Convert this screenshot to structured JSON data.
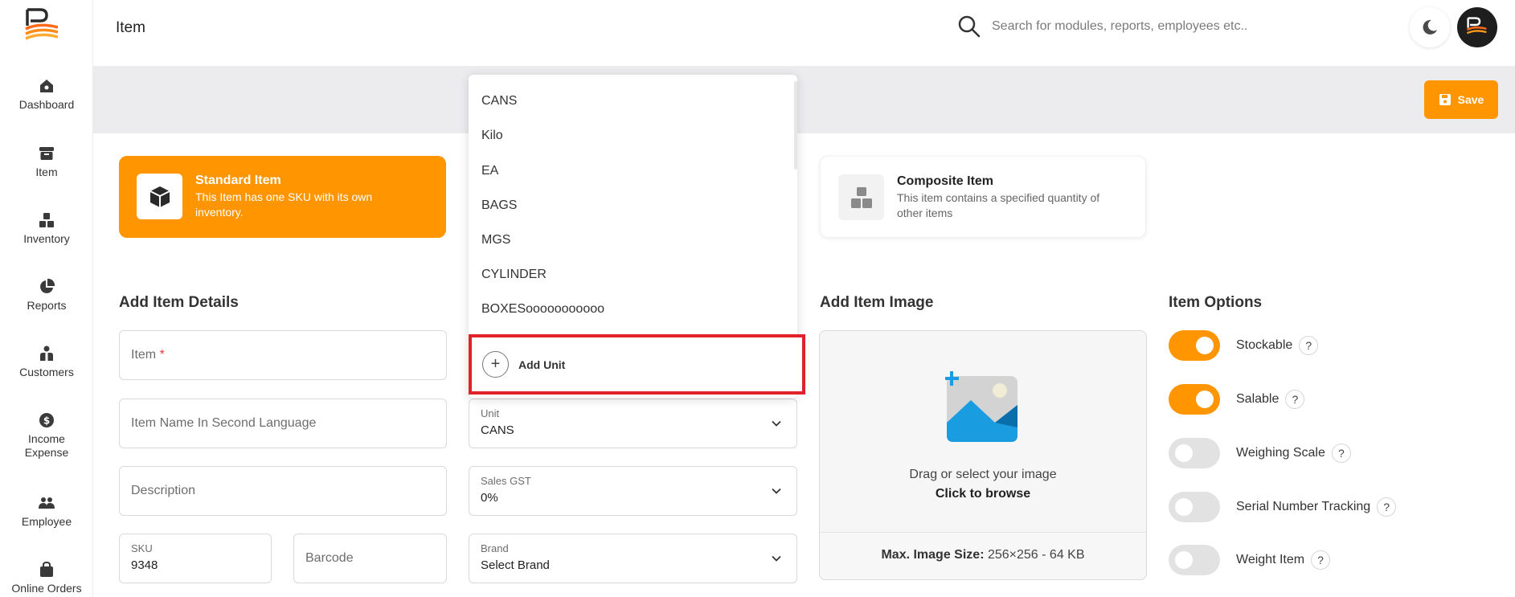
{
  "sidebar": {
    "items": [
      {
        "label": "Dashboard"
      },
      {
        "label": "Item"
      },
      {
        "label": "Inventory"
      },
      {
        "label": "Reports"
      },
      {
        "label": "Customers"
      },
      {
        "label": "Income Expense"
      },
      {
        "label": "Employee"
      },
      {
        "label": "Online Orders"
      }
    ]
  },
  "header": {
    "title": "Item",
    "search_placeholder": "Search for modules, reports, employees etc.."
  },
  "toolbar": {
    "save_label": "Save"
  },
  "item_types": [
    {
      "title": "Standard Item",
      "description": "This Item has one SKU with its own inventory."
    },
    {
      "title": "Composite Item",
      "description": "This item contains a specified quantity of other items"
    }
  ],
  "details": {
    "title": "Add Item Details",
    "item_placeholder": "Item",
    "item_required_mark": "*",
    "second_language_placeholder": "Item Name In Second Language",
    "description_placeholder": "Description",
    "sku_label": "SKU",
    "sku_value": "9348",
    "barcode_placeholder": "Barcode"
  },
  "unit_dropdown": {
    "options": [
      "CANS",
      "Kilo",
      "EA",
      "BAGS",
      "MGS",
      "CYLINDER",
      "BOXESooooooooooo"
    ],
    "add_unit_label": "Add Unit",
    "add_unit_icon": "+"
  },
  "selects": {
    "unit_label": "Unit",
    "unit_value": "CANS",
    "gst_label": "Sales GST",
    "gst_value": "0%",
    "brand_label": "Brand",
    "brand_value": "Select Brand"
  },
  "image": {
    "title": "Add Item Image",
    "drag_text": "Drag or select your image",
    "browse_text": "Click to browse",
    "max_label": "Max. Image Size:",
    "max_value": "256×256 - 64 KB"
  },
  "options": {
    "title": "Item Options",
    "help_symbol": "?",
    "items": [
      {
        "label": "Stockable",
        "on": true
      },
      {
        "label": "Salable",
        "on": true
      },
      {
        "label": "Weighing Scale",
        "on": false
      },
      {
        "label": "Serial Number Tracking",
        "on": false
      },
      {
        "label": "Weight Item",
        "on": false
      }
    ]
  },
  "colors": {
    "accent": "#ff9500",
    "highlight": "#e0232b"
  }
}
